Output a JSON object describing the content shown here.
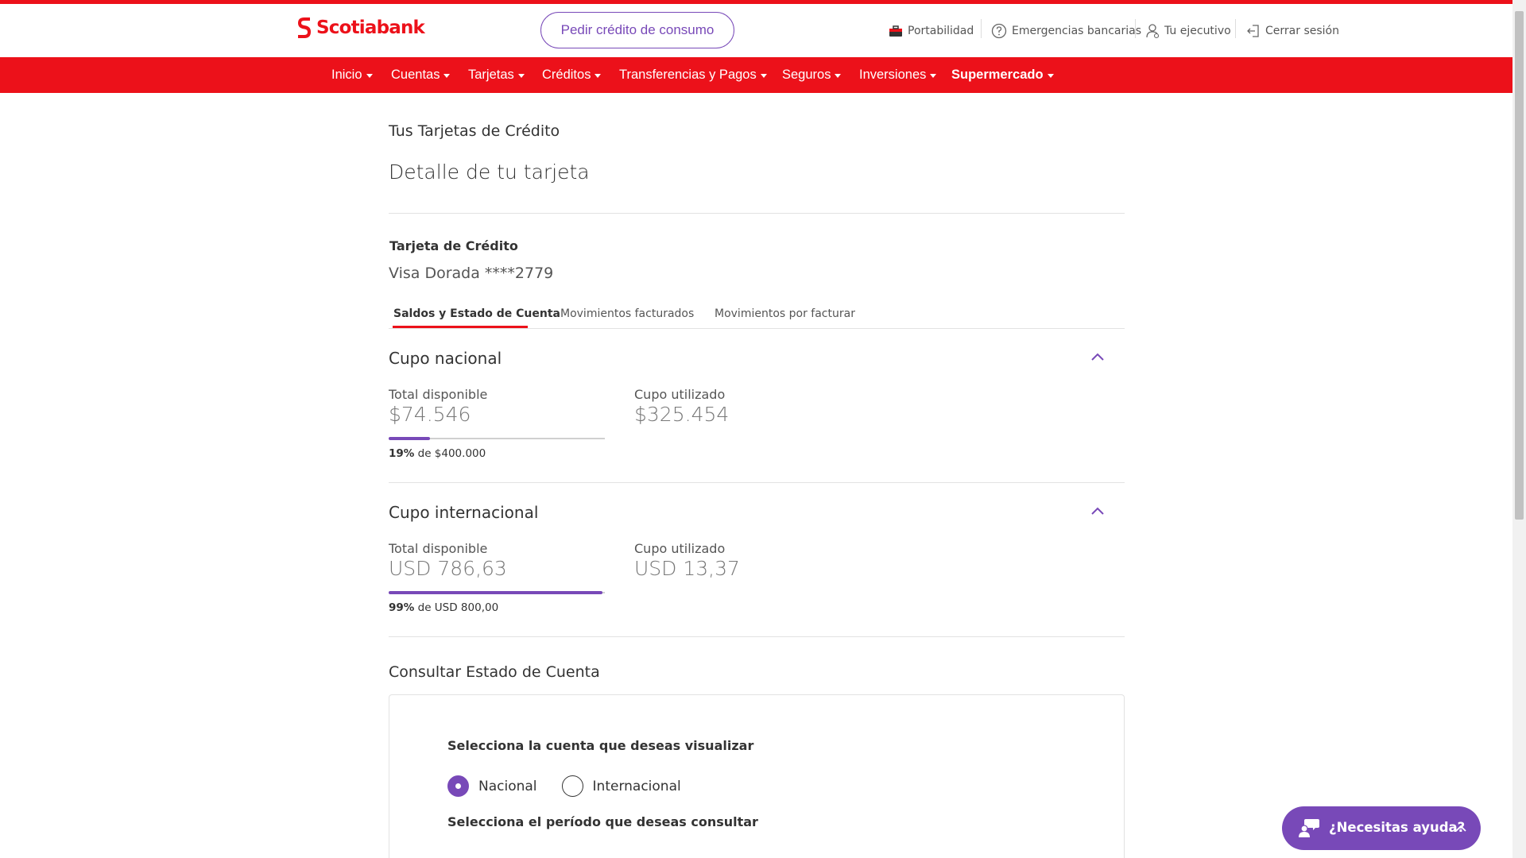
{
  "brand": {
    "name": "Scotiabank",
    "primary_color": "#ec111a",
    "accent_color": "#7849b8"
  },
  "header": {
    "cta_label": "Pedir crédito de consumo",
    "utils": [
      {
        "label": "Portabilidad",
        "icon": "briefcase-icon"
      },
      {
        "label": "Emergencias bancarias",
        "icon": "question-circle-icon"
      },
      {
        "label": "Tu ejecutivo",
        "icon": "user-icon"
      },
      {
        "label": "Cerrar sesión",
        "icon": "logout-icon"
      }
    ]
  },
  "nav": {
    "items": [
      {
        "label": "Inicio"
      },
      {
        "label": "Cuentas"
      },
      {
        "label": "Tarjetas"
      },
      {
        "label": "Créditos"
      },
      {
        "label": "Transferencias y Pagos"
      },
      {
        "label": "Seguros"
      },
      {
        "label": "Inversiones"
      },
      {
        "label": "Supermercado"
      }
    ]
  },
  "page": {
    "section_title": "Tus Tarjetas de Crédito",
    "title": "Detalle de tu tarjeta",
    "card_type": "Tarjeta de Crédito",
    "card_name": "Visa Dorada ****2779"
  },
  "tabs": [
    {
      "label": "Saldos y Estado de Cuenta",
      "active": true
    },
    {
      "label": "Movimientos facturados",
      "active": false
    },
    {
      "label": "Movimientos por facturar",
      "active": false
    }
  ],
  "cupo_nacional": {
    "title": "Cupo nacional",
    "available_label": "Total disponible",
    "available_value": "$74.546",
    "used_label": "Cupo utilizado",
    "used_value": "$325.454",
    "percent": "19%",
    "percent_value": 0.19,
    "of_label": "de $400.000"
  },
  "cupo_internacional": {
    "title": "Cupo internacional",
    "available_label": "Total disponible",
    "available_value": "USD 786,63",
    "used_label": "Cupo utilizado",
    "used_value": "USD 13,37",
    "percent": "99%",
    "percent_value": 0.99,
    "of_label": "de USD 800,00"
  },
  "consult": {
    "title": "Consultar Estado de Cuenta",
    "select_account_label": "Selecciona la cuenta que deseas visualizar",
    "options": [
      {
        "label": "Nacional",
        "checked": true
      },
      {
        "label": "Internacional",
        "checked": false
      }
    ],
    "select_period_label": "Selecciona el período que deseas consultar"
  },
  "help": {
    "label": "¿Necesitas ayuda?"
  }
}
